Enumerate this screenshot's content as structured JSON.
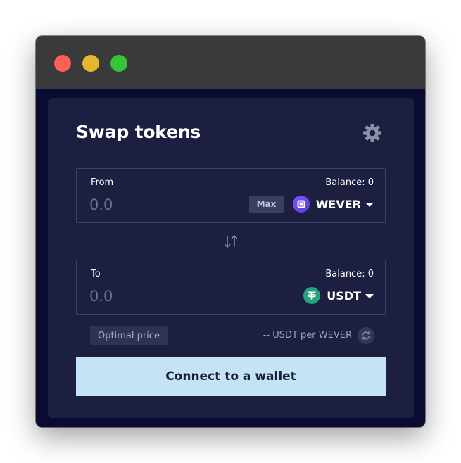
{
  "swap": {
    "title": "Swap tokens",
    "from": {
      "label": "From",
      "balance": "Balance: 0",
      "amount_placeholder": "0.0",
      "max_label": "Max",
      "token": "WEVER"
    },
    "to": {
      "label": "To",
      "balance": "Balance: 0",
      "amount_placeholder": "0.0",
      "token": "USDT"
    },
    "optimal_price_label": "Optimal price",
    "rate": "-- USDT per WEVER",
    "connect_label": "Connect to a wallet"
  },
  "icons": {
    "settings": "gear-icon",
    "swap_direction": "swap-arrows-icon",
    "rate_toggle": "refresh-icon",
    "wever": "wever-token-icon",
    "usdt": "usdt-token-icon"
  },
  "colors": {
    "background": "#090b32",
    "card": "#1c1f3f",
    "accent": "#c4e3f4",
    "usdt": "#27a17b",
    "wever": "#6b4bf0"
  }
}
